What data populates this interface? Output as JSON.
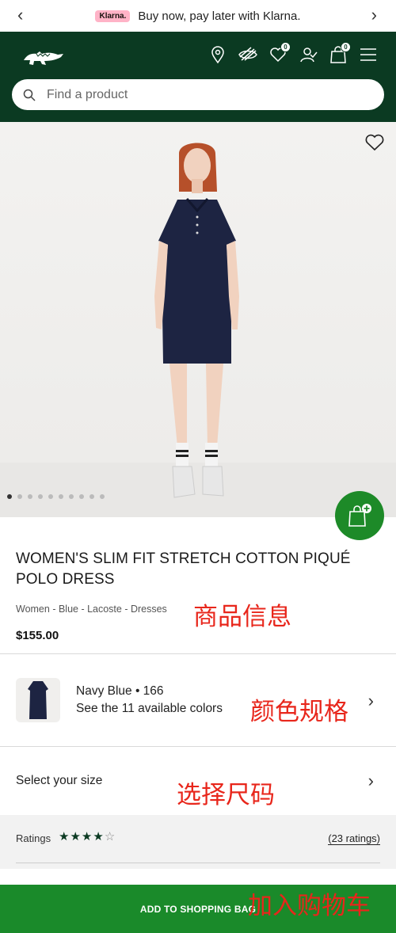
{
  "promo": {
    "klarna_badge": "Klarna.",
    "text": "Buy now, pay later with Klarna.",
    "prev_icon": "chevron-left-icon",
    "next_icon": "chevron-right-icon"
  },
  "header": {
    "logo": "lacoste-crocodile-logo",
    "icons": [
      "location-pin-icon",
      "hide-eye-icon",
      "heart-icon",
      "account-icon",
      "shopping-bag-icon",
      "menu-icon"
    ],
    "wishlist_count": "0",
    "bag_count": "0",
    "search_placeholder": "Find a product"
  },
  "product": {
    "title_line1": "WOMEN'S SLIM FIT STRETCH COTTON PIQUÉ",
    "title_line2": "POLO DRESS",
    "breadcrumb": "Women - Blue - Lacoste - Dresses",
    "price": "$155.00",
    "image_count": 10,
    "active_image": 1
  },
  "color": {
    "name": "Navy Blue • 166",
    "available": "See the 11 available colors"
  },
  "size": {
    "label": "Select your size"
  },
  "ratings": {
    "label": "Ratings",
    "stars": 4,
    "max_stars": 5,
    "count": "(23 ratings)"
  },
  "cart": {
    "label": "ADD TO SHOPPING BAG"
  },
  "annotations": {
    "product_info": "商品信息",
    "color_spec": "颜色规格",
    "select_size": "选择尺码",
    "add_to_cart": "加入购物车"
  },
  "colors": {
    "header_bg": "#0b3a22",
    "cta_green": "#1a8a2a",
    "annotation_red": "#e8261b",
    "klarna_pink": "#ffb3c7"
  }
}
